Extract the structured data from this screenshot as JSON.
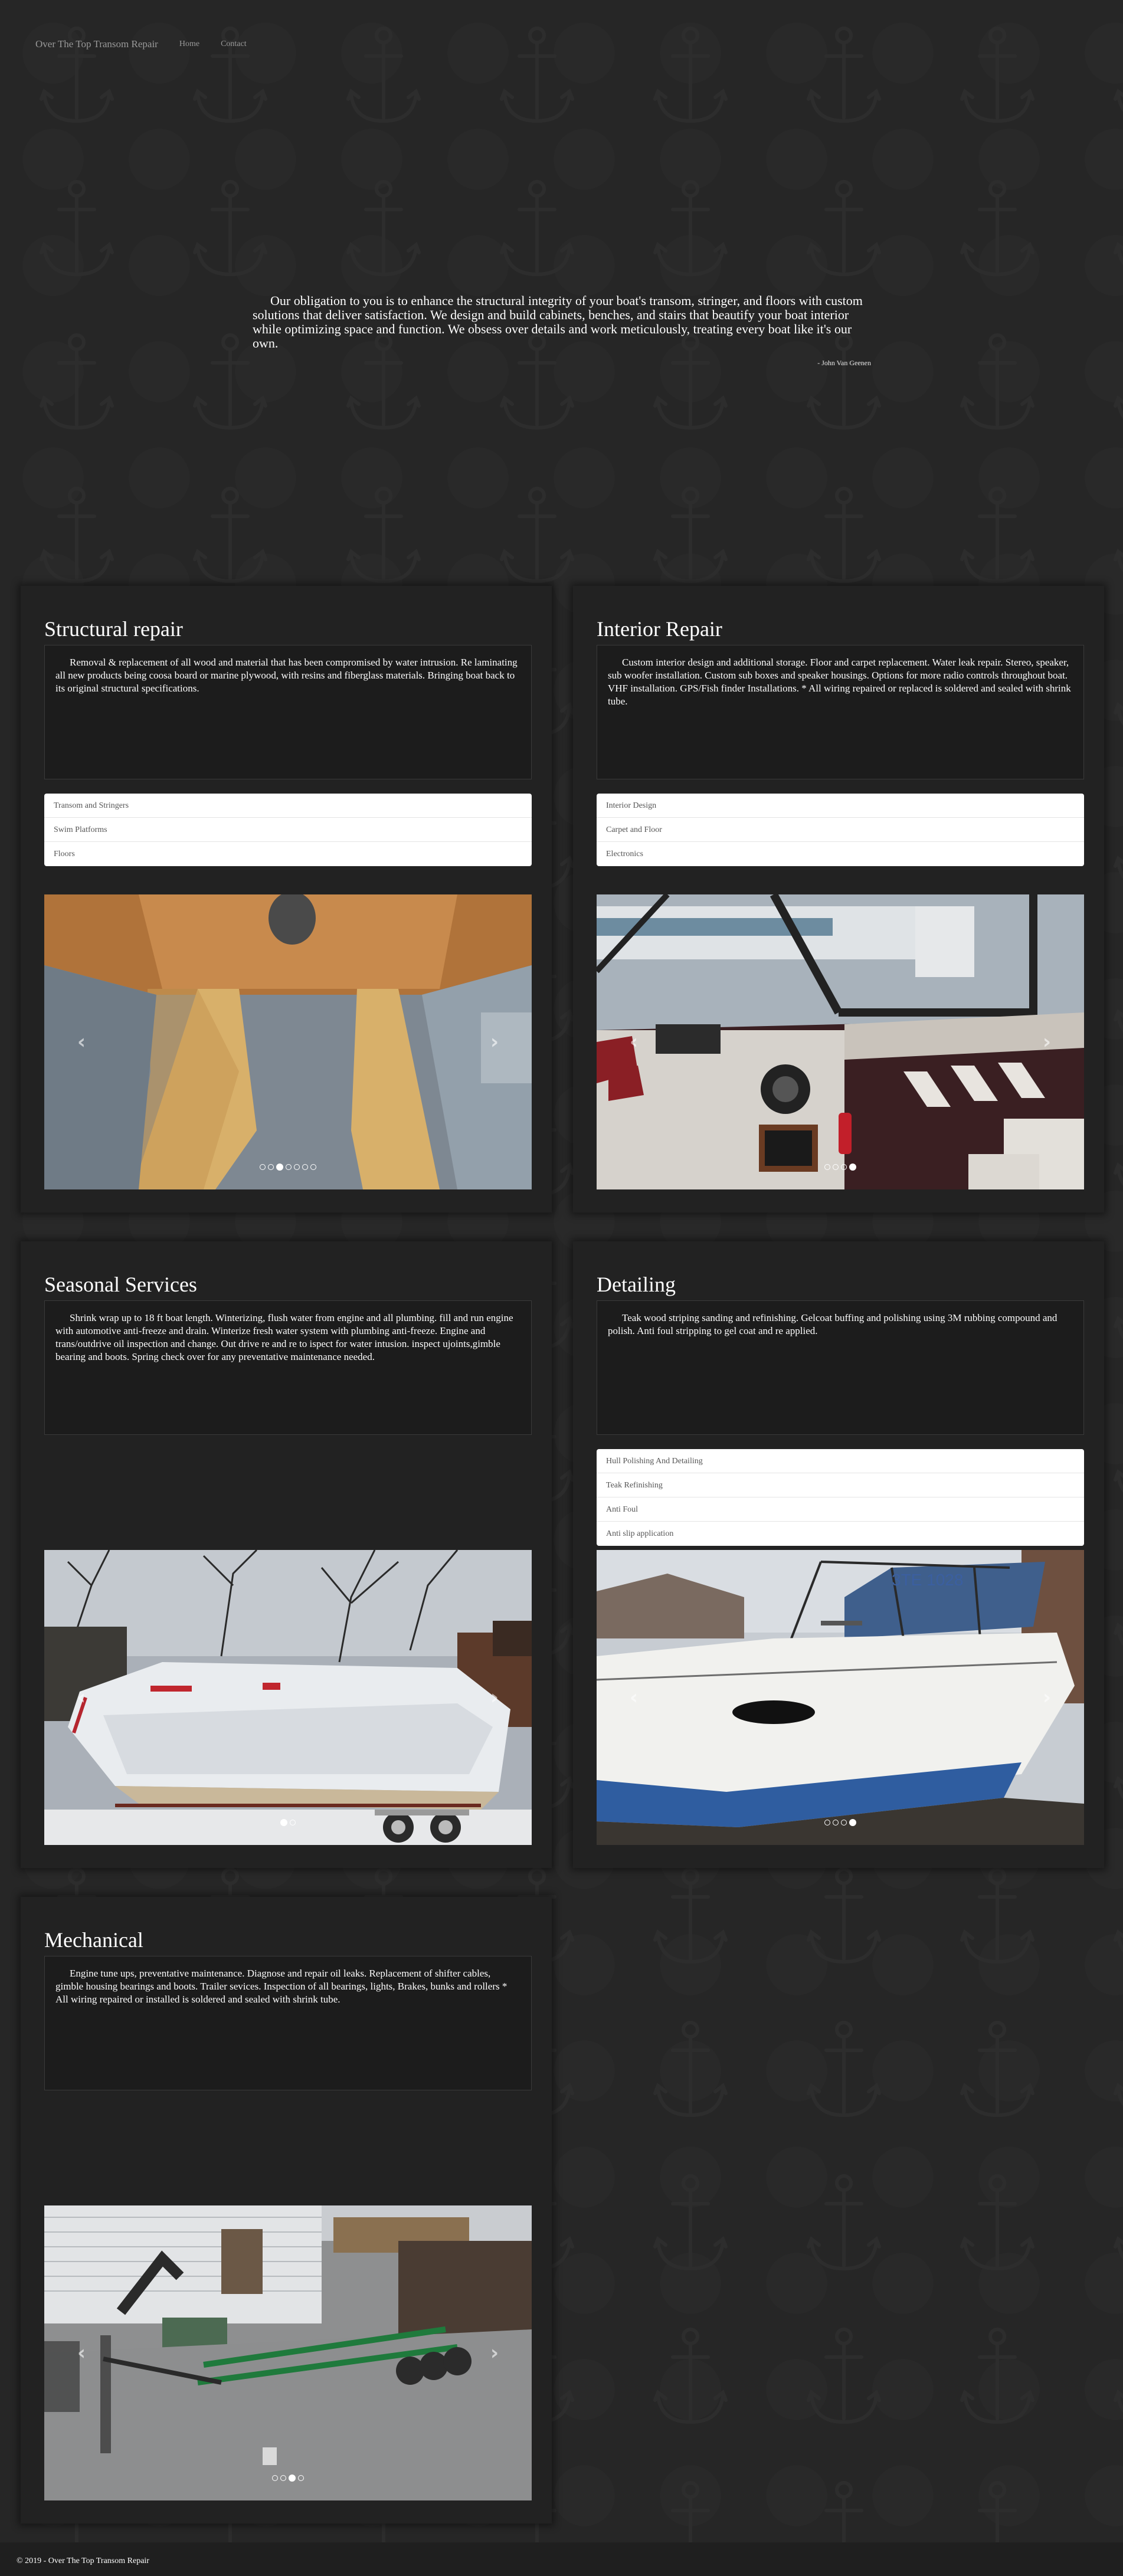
{
  "nav": {
    "brand": "Over The Top Transom Repair",
    "links": [
      "Home",
      "Contact"
    ]
  },
  "hero": {
    "quote": "Our obligation to you is to enhance the structural integrity of your boat's transom, stringer, and floors with custom solutions that deliver satisfaction. We design and build cabinets, benches, and stairs that beautify your boat interior while optimizing space and function. We obsess over details and work meticulously, treating every boat like it's our own.",
    "author": "- John Van Geenen"
  },
  "panels": [
    {
      "title": "Structural repair",
      "description": "Removal & replacement of all wood and material that has been compromised by water intrusion. Re laminating all new products being coosa board or marine plywood, with resins and fiberglass materials. Bringing boat back to its original structural specifications.",
      "items": [
        "Transom and Stringers",
        "Swim Platforms",
        "Floors"
      ],
      "slides": 7,
      "active_slide": 3
    },
    {
      "title": "Interior Repair",
      "description": "Custom interior design and additional storage. Floor and carpet replacement. Water leak repair. Stereo, speaker, sub woofer installation. Custom sub boxes and speaker housings. Options for more radio controls throughout boat. VHF installation. GPS/Fish finder Installations. * All wiring repaired or replaced is soldered and sealed with shrink tube.",
      "items": [
        "Interior Design",
        "Carpet and Floor",
        "Electronics"
      ],
      "slides": 4,
      "active_slide": 4
    },
    {
      "title": "Seasonal Services",
      "description": "Shrink wrap up to 18 ft boat length. Winterizing, flush water from engine and all plumbing. fill and run engine with automotive anti-freeze and drain. Winterize fresh water system with plumbing anti-freeze. Engine and trans/outdrive oil inspection and change. Out drive re and re to ispect for water intusion. inspect ujoints,gimble bearing and boots. Spring check over for any preventative maintenance needed.",
      "items": [],
      "slides": 2,
      "active_slide": 1
    },
    {
      "title": "Detailing",
      "description": "Teak wood striping sanding and refinishing. Gelcoat buffing and polishing using 3M rubbing compound and polish. Anti foul stripping to gel coat and re applied.",
      "items": [
        "Hull Polishing And Detailing",
        "Teak Refinishing",
        "Anti Foul",
        "Anti slip application"
      ],
      "slides": 4,
      "active_slide": 4
    },
    {
      "title": "Mechanical",
      "description": "Engine tune ups, preventative maintenance. Diagnose and repair oil leaks. Replacement of shifter cables, gimble housing bearings and boots. Trailer sevices. Inspection of all bearings, lights, Brakes, bunks and rollers * All wiring repaired or installed is soldered and sealed with shrink tube.",
      "items": [],
      "slides": 4,
      "active_slide": 3
    }
  ],
  "carousel": {
    "prev_icon": "chevron-left-icon",
    "next_icon": "chevron-right-icon"
  },
  "footer": {
    "text": "© 2019 - Over The Top Transom Repair"
  },
  "colors": {
    "background": "#262626",
    "panel": "#222222",
    "description_box": "#1c1c1c",
    "nav_text": "#9a9a9a"
  }
}
